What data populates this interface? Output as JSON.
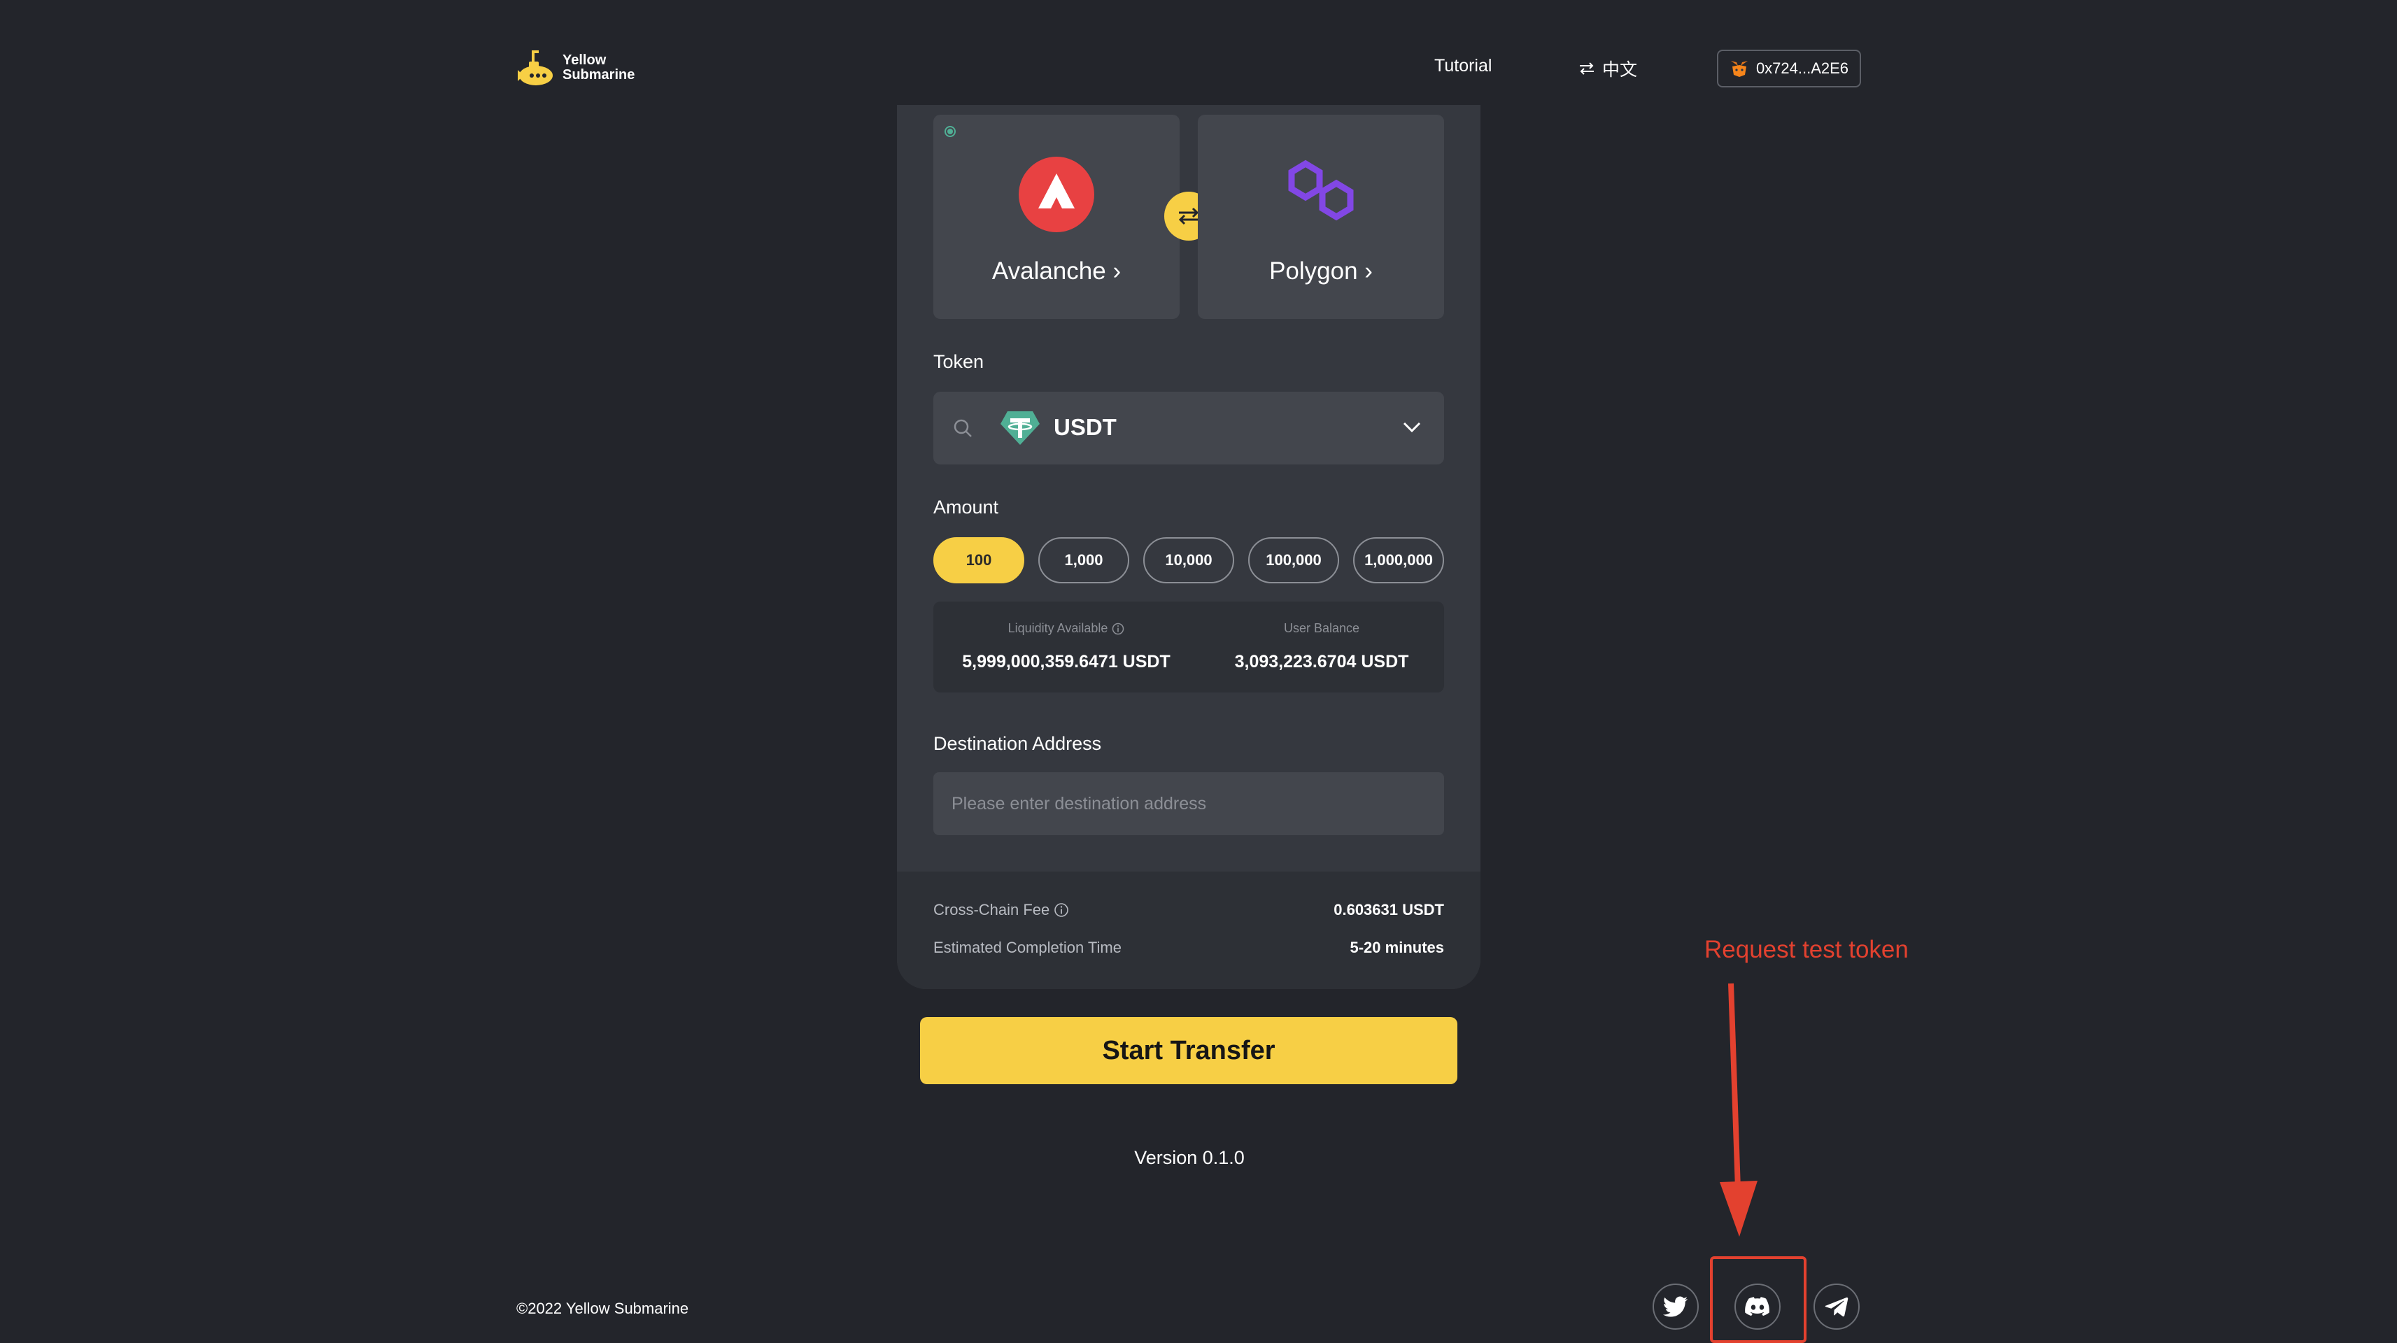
{
  "header": {
    "logo_line1": "Yellow",
    "logo_line2": "Submarine",
    "tutorial": "Tutorial",
    "language": "中文",
    "wallet_address": "0x724...A2E6"
  },
  "bridge": {
    "from_chain": "Avalanche",
    "to_chain": "Polygon",
    "token_label": "Token",
    "token_value": "USDT",
    "amount_label": "Amount",
    "amount_options": [
      "100",
      "1,000",
      "10,000",
      "100,000",
      "1,000,000"
    ],
    "amount_selected": "100",
    "liquidity_label": "Liquidity Available",
    "liquidity_value": "5,999,000,359.6471 USDT",
    "balance_label": "User Balance",
    "balance_value": "3,093,223.6704 USDT",
    "destination_label": "Destination Address",
    "destination_placeholder": "Please enter destination address",
    "fee_label": "Cross-Chain Fee",
    "fee_value": "0.603631 USDT",
    "time_label": "Estimated Completion Time",
    "time_value": "5-20 minutes",
    "start_button": "Start Transfer"
  },
  "footer": {
    "version": "Version 0.1.0",
    "copyright": "©2022 Yellow Submarine",
    "socials": [
      "twitter-icon",
      "discord-icon",
      "telegram-icon"
    ]
  },
  "annotation": {
    "text": "Request test token",
    "color": "#e3412f"
  },
  "colors": {
    "accent": "#f7cf45",
    "background": "#23252b",
    "card": "#35383f",
    "avalanche": "#e84142",
    "polygon": "#8247e5",
    "tether": "#50af95"
  }
}
